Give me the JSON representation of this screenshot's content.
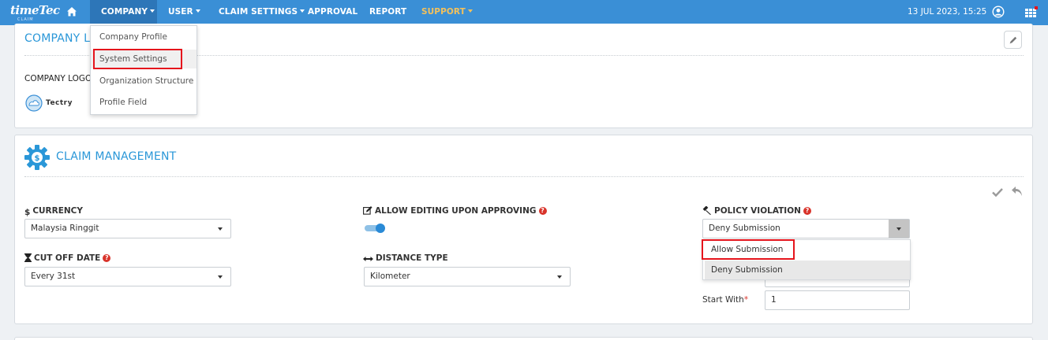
{
  "nav": {
    "logo_text": "timeTec",
    "logo_sub": "CLAIM",
    "items": [
      {
        "label": "COMPANY",
        "caret": true
      },
      {
        "label": "USER",
        "caret": true
      },
      {
        "label": "CLAIM SETTINGS",
        "caret": true
      },
      {
        "label": "APPROVAL",
        "caret": false
      },
      {
        "label": "REPORT",
        "caret": false
      },
      {
        "label": "SUPPORT",
        "caret": true
      }
    ],
    "datetime": "13 JUL 2023, 15:25",
    "accent": "#3a8fd6",
    "active_bg": "#2d76b8",
    "support_color": "#f2c15c"
  },
  "company_menu": {
    "items": [
      "Company Profile",
      "System Settings",
      "Organization Structure",
      "Profile Field"
    ],
    "highlighted_index": 1
  },
  "company_logo_panel": {
    "title_visible": "COMPANY LO",
    "logo_label": "COMPANY LOGO",
    "logo_brand_text": "Tectry"
  },
  "claim_panel": {
    "title": "CLAIM MANAGEMENT",
    "currency": {
      "label": "CURRENCY",
      "value": "Malaysia Ringgit"
    },
    "cutoff": {
      "label": "CUT OFF DATE",
      "value": "Every 31st"
    },
    "allow_editing": {
      "label": "ALLOW EDITING UPON APPROVING",
      "enabled": true
    },
    "distance": {
      "label": "DISTANCE TYPE",
      "value": "Kilometer"
    },
    "policy": {
      "label": "POLICY VIOLATION",
      "value": "Deny Submission",
      "options": [
        "Allow Submission",
        "Deny Submission"
      ],
      "selected_index": 1
    },
    "start_with": {
      "label": "Start With",
      "required_mark": "*",
      "value": "1"
    }
  },
  "colors": {
    "title_blue": "#2a97d8",
    "highlight_red": "#e5141c",
    "help_red": "#d9342b"
  }
}
